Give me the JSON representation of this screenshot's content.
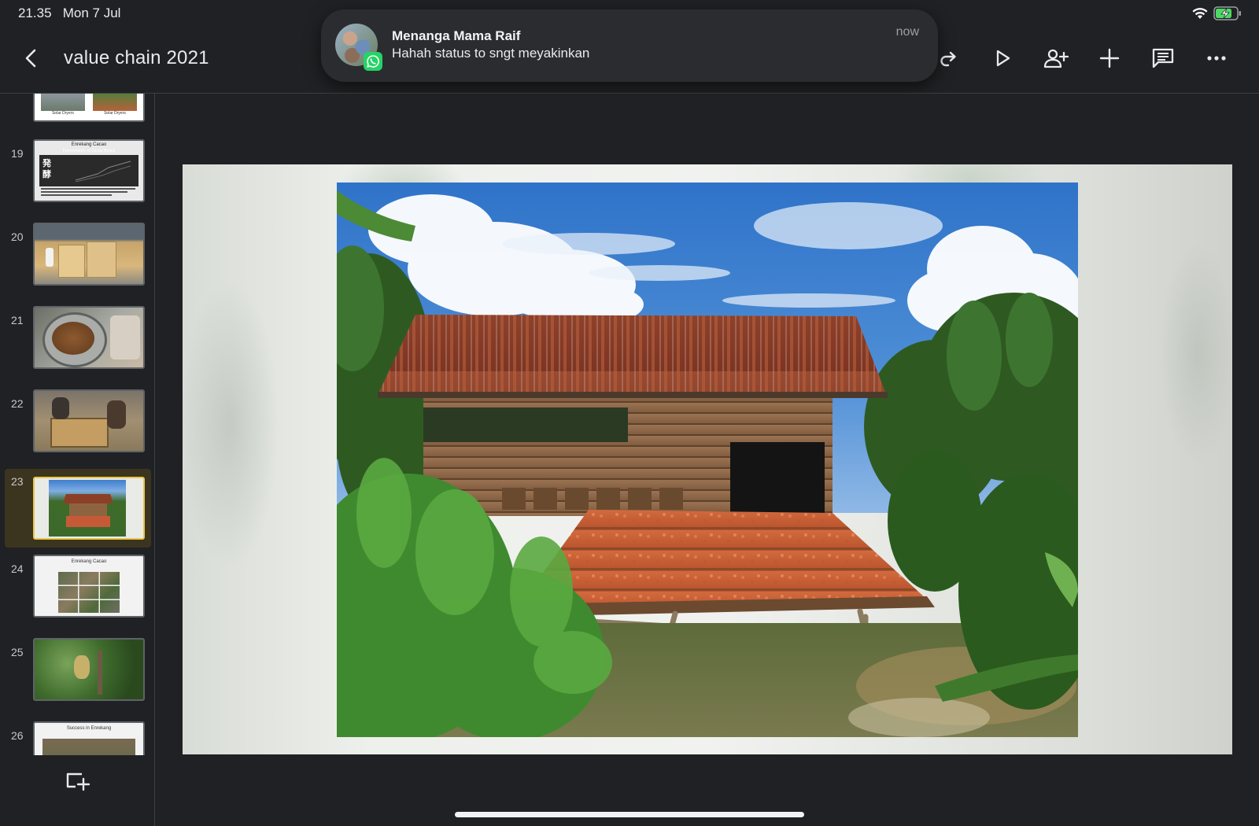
{
  "status_bar": {
    "time": "21.35",
    "date": "Mon 7 Jul"
  },
  "header": {
    "title": "value chain  2021"
  },
  "toolbar": {
    "icons": [
      "redo-icon",
      "play-icon",
      "share-icon",
      "insert-icon",
      "comments-icon",
      "more-icon"
    ]
  },
  "notification": {
    "sender": "Menanga Mama Raif",
    "message": "Hahah status to sngt meyakinkan",
    "time": "now",
    "app": "WhatsApp"
  },
  "slides": {
    "selected": 23,
    "items": [
      {
        "number": "",
        "caption_left": "Solar Dryers",
        "caption_right": "Solar Dryers"
      },
      {
        "number": "19",
        "heading": "Enrekang Cacao",
        "subheading": "Fermentation of Cacao Beans",
        "kanji": "発 酵"
      },
      {
        "number": "20"
      },
      {
        "number": "21"
      },
      {
        "number": "22"
      },
      {
        "number": "23"
      },
      {
        "number": "24",
        "heading": "Enrekang Cacao"
      },
      {
        "number": "25"
      },
      {
        "number": "26",
        "heading": "Success in Enrekang"
      }
    ]
  },
  "colors": {
    "app_background": "#202124",
    "selection_border": "#e8c64a",
    "selection_fill": "#3b3520",
    "whatsapp_green": "#25d366"
  }
}
